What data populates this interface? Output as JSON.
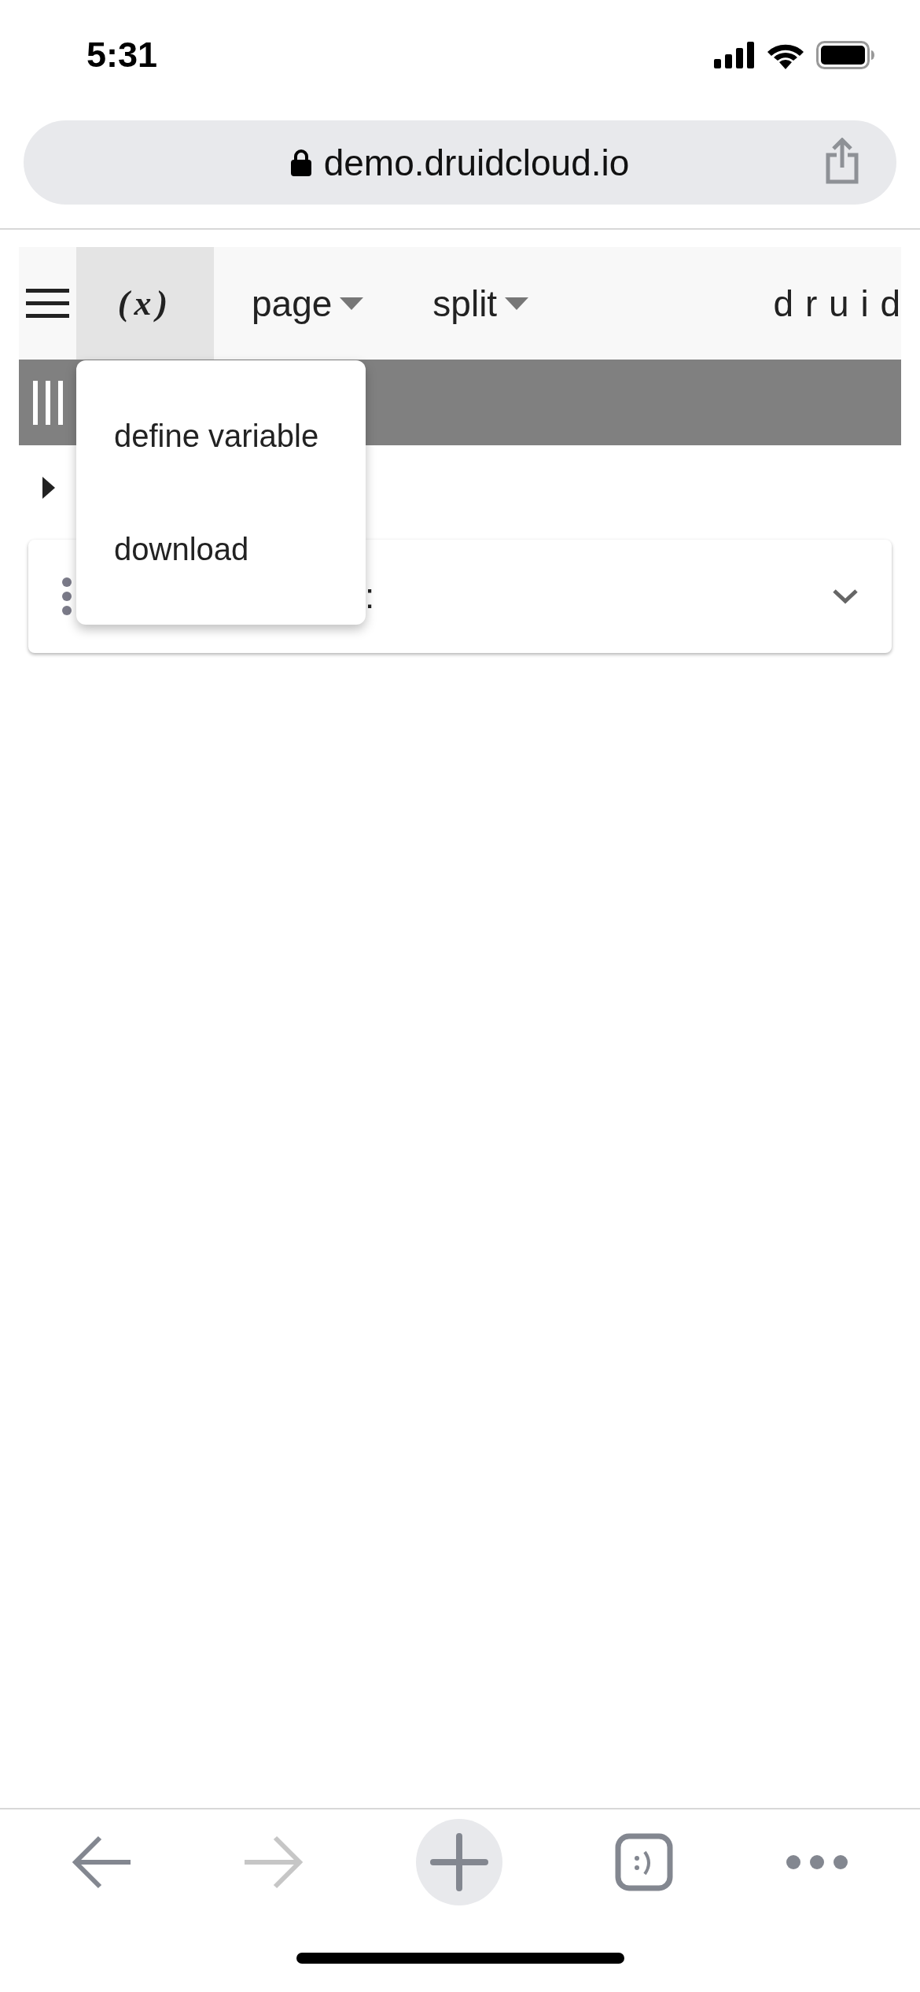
{
  "status_bar": {
    "time": "5:31"
  },
  "address_bar": {
    "url": "demo.druidcloud.io"
  },
  "toolbar": {
    "items": [
      {
        "kind": "function",
        "label": "(x)",
        "selected": true
      },
      {
        "kind": "dropdown",
        "label": "page",
        "selected": false
      },
      {
        "kind": "dropdown",
        "label": "split",
        "selected": false
      }
    ],
    "brand": "d r u i d"
  },
  "menu": {
    "items": [
      {
        "label": "define variable"
      },
      {
        "label": "download"
      }
    ]
  },
  "card": {
    "label": ":",
    "expanded": false
  },
  "browser_nav": {
    "forward_disabled": true
  }
}
